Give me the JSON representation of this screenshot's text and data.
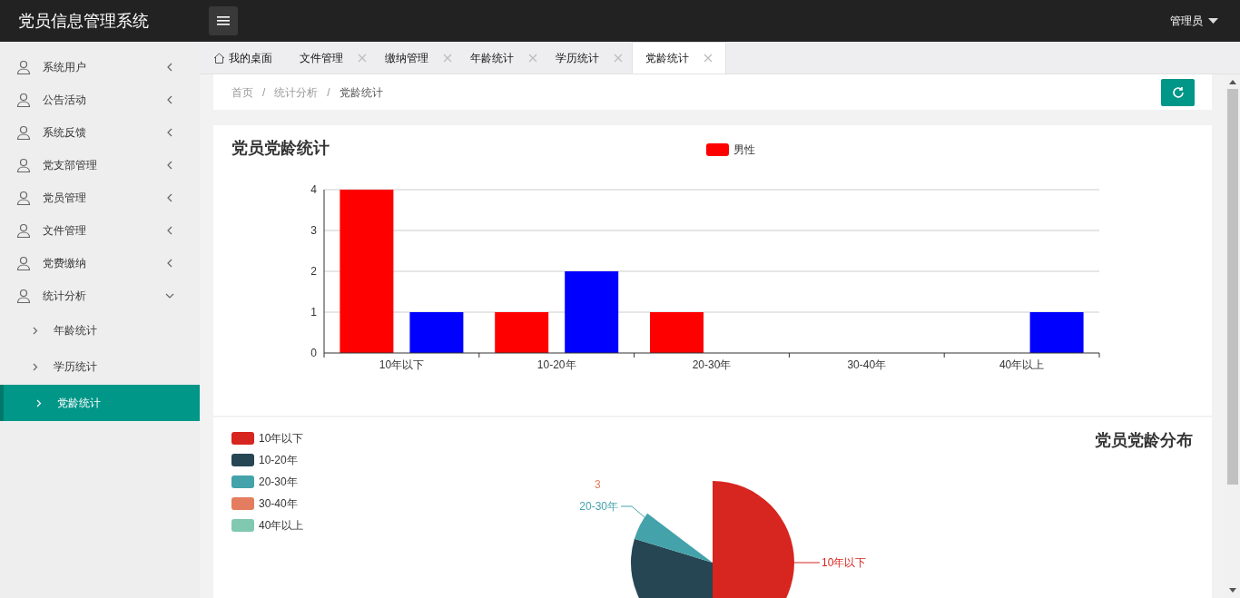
{
  "header": {
    "title": "党员信息管理系统",
    "user": "管理员"
  },
  "sidebar": {
    "items": [
      {
        "label": "系统用户",
        "expanded": false
      },
      {
        "label": "公告活动",
        "expanded": false
      },
      {
        "label": "系统反馈",
        "expanded": false
      },
      {
        "label": "党支部管理",
        "expanded": false
      },
      {
        "label": "党员管理",
        "expanded": false
      },
      {
        "label": "文件管理",
        "expanded": false
      },
      {
        "label": "党费缴纳",
        "expanded": false
      },
      {
        "label": "统计分析",
        "expanded": true,
        "children": [
          {
            "label": "年龄统计",
            "selected": false
          },
          {
            "label": "学历统计",
            "selected": false
          },
          {
            "label": "党龄统计",
            "selected": true
          }
        ]
      }
    ]
  },
  "tabs": [
    {
      "label": "我的桌面",
      "kind": "home",
      "selected": false
    },
    {
      "label": "文件管理",
      "kind": "closable",
      "selected": false
    },
    {
      "label": "缴纳管理",
      "kind": "closable",
      "selected": false
    },
    {
      "label": "年龄统计",
      "kind": "closable",
      "selected": false
    },
    {
      "label": "学历统计",
      "kind": "closable",
      "selected": false
    },
    {
      "label": "党龄统计",
      "kind": "closable",
      "selected": true
    }
  ],
  "breadcrumb": {
    "items": [
      "首页",
      "统计分析",
      "党龄统计"
    ],
    "separator": "/"
  },
  "bar_card": {
    "title": "党员党龄统计",
    "chart_data": {
      "type": "bar",
      "categories": [
        "10年以下",
        "10-20年",
        "20-30年",
        "30-40年",
        "40年以上"
      ],
      "ylim": [
        0,
        4
      ],
      "grid": true,
      "yticks": [
        0,
        1,
        2,
        3,
        4
      ],
      "series": [
        {
          "name": "男性",
          "color": "#ff0000",
          "values": [
            4,
            1,
            1,
            0,
            0
          ]
        },
        {
          "color": "#0000ff",
          "values": [
            1,
            2,
            0,
            0,
            1
          ]
        }
      ]
    }
  },
  "pie_card": {
    "title": "党员党龄分布",
    "legend": [
      {
        "label": "10年以下",
        "color": "#d7251f"
      },
      {
        "label": "10-20年",
        "color": "#264653"
      },
      {
        "label": "20-30年",
        "color": "#43a2aa"
      },
      {
        "label": "30-40年",
        "color": "#e47d5f"
      },
      {
        "label": "40年以上",
        "color": "#80c9b0"
      }
    ],
    "slice_labels": [
      {
        "text": "3",
        "color": "#e47d5f"
      },
      {
        "text": "20-30年",
        "color": "#43a2aa"
      },
      {
        "text": "10年以下",
        "color": "#d7251f"
      }
    ]
  }
}
